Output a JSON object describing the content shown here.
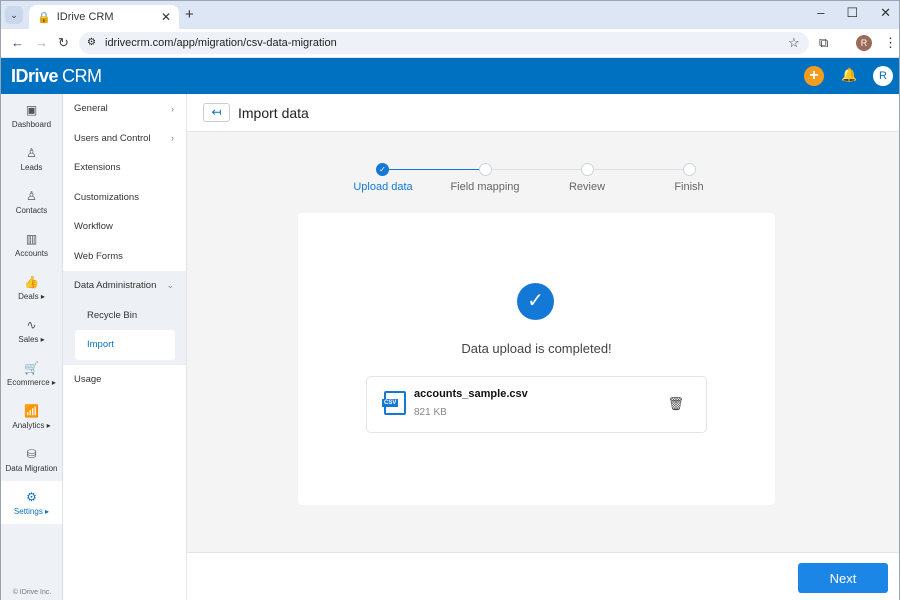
{
  "browser": {
    "tab_title": "IDrive CRM",
    "url": "idrivecrm.com/app/migration/csv-data-migration",
    "profile_initial": "R"
  },
  "app": {
    "logo": "IDrive",
    "logo_suffix": "CRM",
    "user_initial": "R",
    "brand_color": "#0070c0",
    "accent_color": "#1479d6"
  },
  "rail": {
    "items": [
      {
        "label": "Dashboard",
        "icon": "▣"
      },
      {
        "label": "Leads",
        "icon": "♙"
      },
      {
        "label": "Contacts",
        "icon": "♙"
      },
      {
        "label": "Accounts",
        "icon": "▥"
      },
      {
        "label": "Deals ▸",
        "icon": "👍"
      },
      {
        "label": "Sales ▸",
        "icon": "∿"
      },
      {
        "label": "Ecommerce ▸",
        "icon": "🛒"
      },
      {
        "label": "Analytics ▸",
        "icon": "📶"
      },
      {
        "label": "Data Migration",
        "icon": "⛁"
      },
      {
        "label": "Settings ▸",
        "icon": "⚙"
      }
    ],
    "copyright": "© IDrive Inc."
  },
  "menu": {
    "items": [
      "General",
      "Users and Control",
      "Extensions",
      "Customizations",
      "Workflow",
      "Web Forms"
    ],
    "group": "Data Administration",
    "subitems": [
      "Recycle Bin",
      "Import"
    ],
    "after": "Usage"
  },
  "main": {
    "title": "Import data",
    "steps": [
      "Upload data",
      "Field mapping",
      "Review",
      "Finish"
    ],
    "message": "Data upload is completed!",
    "file": {
      "name": "accounts_sample.csv",
      "size": "821 KB",
      "type": "CSV"
    },
    "next_label": "Next"
  }
}
